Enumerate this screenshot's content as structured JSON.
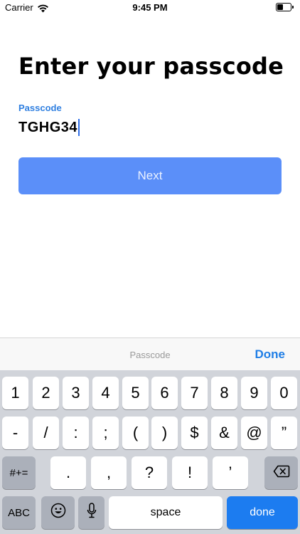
{
  "status_bar": {
    "carrier": "Carrier",
    "time": "9:45 PM",
    "battery_level_fraction": 0.45
  },
  "page": {
    "title": "Enter your passcode",
    "field_label": "Passcode",
    "field_value": "TGHG34",
    "next_label": "Next"
  },
  "accessory_bar": {
    "title": "Passcode",
    "done_label": "Done"
  },
  "keyboard": {
    "row1": [
      "1",
      "2",
      "3",
      "4",
      "5",
      "6",
      "7",
      "8",
      "9",
      "0"
    ],
    "row2": [
      "-",
      "/",
      ":",
      ";",
      "(",
      ")",
      "$",
      "&",
      "@",
      "”"
    ],
    "symbols_key": "#+=",
    "row3": [
      ".",
      ",",
      "?",
      "!",
      "’"
    ],
    "abc_key": "ABC",
    "space_key": "space",
    "return_key": "done"
  },
  "colors": {
    "accent": "#1f7ee6",
    "button": "#5b8ff9",
    "keyboard_bg": "#d1d4da"
  },
  "icons": {
    "wifi": "wifi-icon",
    "battery": "battery-icon",
    "backspace": "backspace-icon",
    "emoji": "emoji-icon",
    "mic": "microphone-icon"
  }
}
